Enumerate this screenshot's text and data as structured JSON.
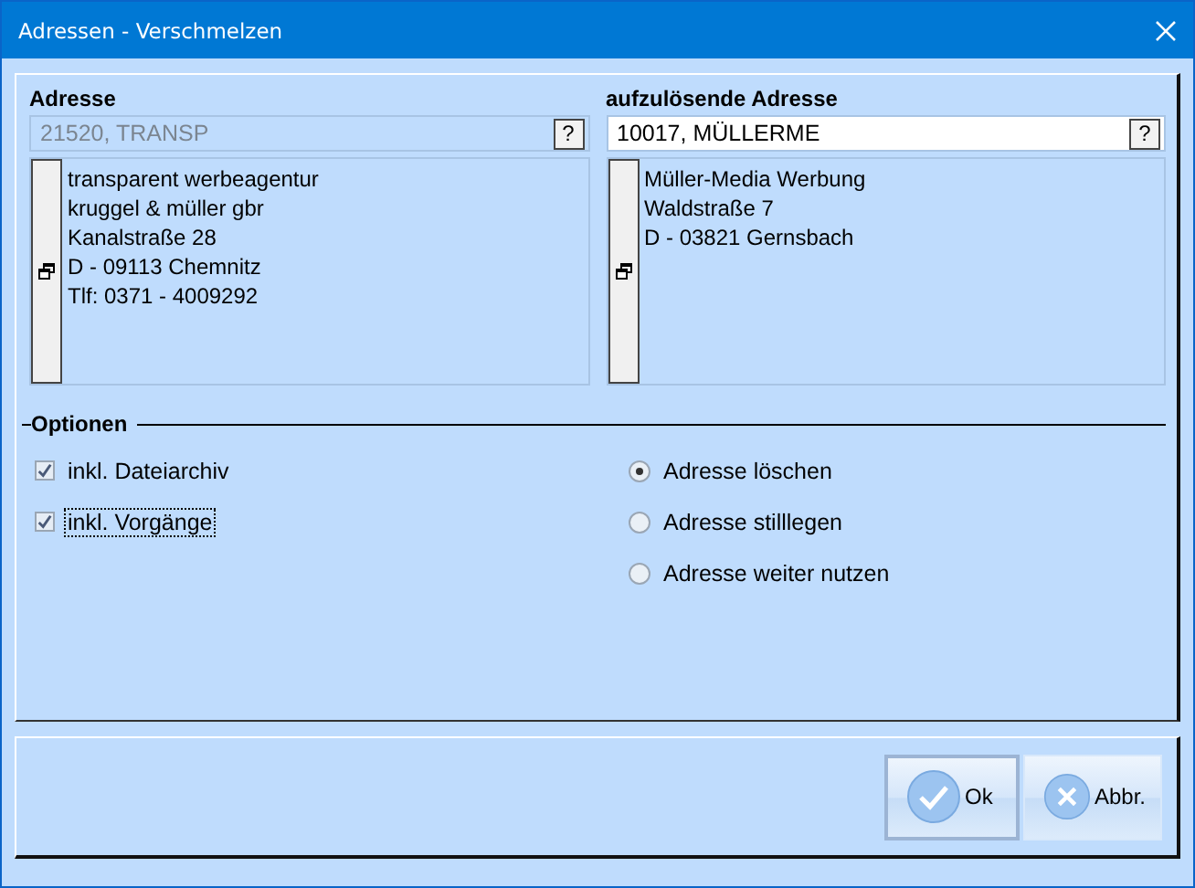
{
  "window": {
    "title": "Adressen - Verschmelzen"
  },
  "addresses": [
    {
      "label": "Adresse",
      "value": "21520, TRANSP",
      "disabled": true,
      "lookup": "?",
      "lines": [
        "transparent werbeagentur",
        "kruggel & müller gbr",
        "Kanalstraße 28",
        "D - 09113 Chemnitz",
        "Tlf: 0371 - 4009292"
      ]
    },
    {
      "label": "aufzulösende Adresse",
      "value": "10017, MÜLLERME",
      "disabled": false,
      "lookup": "?",
      "lines": [
        "Müller-Media Werbung",
        "Waldstraße 7",
        "D - 03821 Gernsbach"
      ]
    }
  ],
  "options": {
    "title": "Optionen",
    "checkboxes": [
      {
        "label": "inkl. Dateiarchiv",
        "checked": true,
        "focused": false
      },
      {
        "label": "inkl. Vorgänge",
        "checked": true,
        "focused": true
      }
    ],
    "radios": [
      {
        "label": "Adresse löschen",
        "selected": true
      },
      {
        "label": "Adresse stilllegen",
        "selected": false
      },
      {
        "label": "Adresse weiter nutzen",
        "selected": false
      }
    ]
  },
  "buttons": [
    {
      "label": "Ok",
      "kind": "ok",
      "default": true
    },
    {
      "label": "Abbr.",
      "kind": "cancel",
      "default": false
    }
  ]
}
